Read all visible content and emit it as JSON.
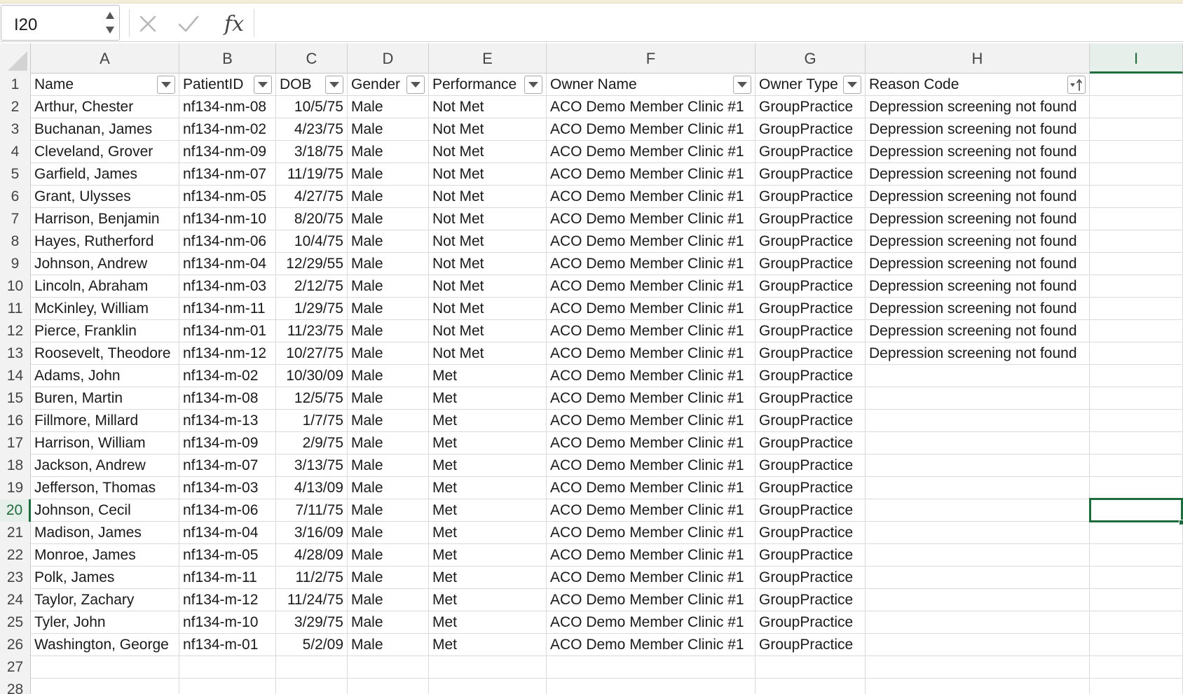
{
  "formula_bar": {
    "name_box": "I20",
    "cancel_icon": "close-icon",
    "enter_icon": "check-icon",
    "function_label": "fx",
    "formula": ""
  },
  "columns": [
    "A",
    "B",
    "C",
    "D",
    "E",
    "F",
    "G",
    "H",
    "I"
  ],
  "active_column": "I",
  "active_row": "20",
  "headers": [
    "Name",
    "PatientID",
    "DOB",
    "Gender",
    "Performance",
    "Owner Name",
    "Owner Type",
    "Reason Code"
  ],
  "sorted_column": "Reason Code",
  "rows": [
    [
      "Arthur, Chester",
      "nf134-nm-08",
      "10/5/75",
      "Male",
      "Not Met",
      "ACO Demo Member Clinic #1",
      "GroupPractice",
      "Depression screening not found"
    ],
    [
      "Buchanan, James",
      "nf134-nm-02",
      "4/23/75",
      "Male",
      "Not Met",
      "ACO Demo Member Clinic #1",
      "GroupPractice",
      "Depression screening not found"
    ],
    [
      "Cleveland, Grover",
      "nf134-nm-09",
      "3/18/75",
      "Male",
      "Not Met",
      "ACO Demo Member Clinic #1",
      "GroupPractice",
      "Depression screening not found"
    ],
    [
      "Garfield, James",
      "nf134-nm-07",
      "11/19/75",
      "Male",
      "Not Met",
      "ACO Demo Member Clinic #1",
      "GroupPractice",
      "Depression screening not found"
    ],
    [
      "Grant, Ulysses",
      "nf134-nm-05",
      "4/27/75",
      "Male",
      "Not Met",
      "ACO Demo Member Clinic #1",
      "GroupPractice",
      "Depression screening not found"
    ],
    [
      "Harrison, Benjamin",
      "nf134-nm-10",
      "8/20/75",
      "Male",
      "Not Met",
      "ACO Demo Member Clinic #1",
      "GroupPractice",
      "Depression screening not found"
    ],
    [
      "Hayes, Rutherford",
      "nf134-nm-06",
      "10/4/75",
      "Male",
      "Not Met",
      "ACO Demo Member Clinic #1",
      "GroupPractice",
      "Depression screening not found"
    ],
    [
      "Johnson, Andrew",
      "nf134-nm-04",
      "12/29/55",
      "Male",
      "Not Met",
      "ACO Demo Member Clinic #1",
      "GroupPractice",
      "Depression screening not found"
    ],
    [
      "Lincoln, Abraham",
      "nf134-nm-03",
      "2/12/75",
      "Male",
      "Not Met",
      "ACO Demo Member Clinic #1",
      "GroupPractice",
      "Depression screening not found"
    ],
    [
      "McKinley, William",
      "nf134-nm-11",
      "1/29/75",
      "Male",
      "Not Met",
      "ACO Demo Member Clinic #1",
      "GroupPractice",
      "Depression screening not found"
    ],
    [
      "Pierce, Franklin",
      "nf134-nm-01",
      "11/23/75",
      "Male",
      "Not Met",
      "ACO Demo Member Clinic #1",
      "GroupPractice",
      "Depression screening not found"
    ],
    [
      "Roosevelt, Theodore",
      "nf134-nm-12",
      "10/27/75",
      "Male",
      "Not Met",
      "ACO Demo Member Clinic #1",
      "GroupPractice",
      "Depression screening not found"
    ],
    [
      "Adams, John",
      "nf134-m-02",
      "10/30/09",
      "Male",
      "Met",
      "ACO Demo Member Clinic #1",
      "GroupPractice",
      ""
    ],
    [
      "Buren, Martin",
      "nf134-m-08",
      "12/5/75",
      "Male",
      "Met",
      "ACO Demo Member Clinic #1",
      "GroupPractice",
      ""
    ],
    [
      "Fillmore, Millard",
      "nf134-m-13",
      "1/7/75",
      "Male",
      "Met",
      "ACO Demo Member Clinic #1",
      "GroupPractice",
      ""
    ],
    [
      "Harrison, William",
      "nf134-m-09",
      "2/9/75",
      "Male",
      "Met",
      "ACO Demo Member Clinic #1",
      "GroupPractice",
      ""
    ],
    [
      "Jackson, Andrew",
      "nf134-m-07",
      "3/13/75",
      "Male",
      "Met",
      "ACO Demo Member Clinic #1",
      "GroupPractice",
      ""
    ],
    [
      "Jefferson, Thomas",
      "nf134-m-03",
      "4/13/09",
      "Male",
      "Met",
      "ACO Demo Member Clinic #1",
      "GroupPractice",
      ""
    ],
    [
      "Johnson, Cecil",
      "nf134-m-06",
      "7/11/75",
      "Male",
      "Met",
      "ACO Demo Member Clinic #1",
      "GroupPractice",
      ""
    ],
    [
      "Madison, James",
      "nf134-m-04",
      "3/16/09",
      "Male",
      "Met",
      "ACO Demo Member Clinic #1",
      "GroupPractice",
      ""
    ],
    [
      "Monroe, James",
      "nf134-m-05",
      "4/28/09",
      "Male",
      "Met",
      "ACO Demo Member Clinic #1",
      "GroupPractice",
      ""
    ],
    [
      "Polk, James",
      "nf134-m-11",
      "11/2/75",
      "Male",
      "Met",
      "ACO Demo Member Clinic #1",
      "GroupPractice",
      ""
    ],
    [
      "Taylor, Zachary",
      "nf134-m-12",
      "11/24/75",
      "Male",
      "Met",
      "ACO Demo Member Clinic #1",
      "GroupPractice",
      ""
    ],
    [
      "Tyler, John",
      "nf134-m-10",
      "3/29/75",
      "Male",
      "Met",
      "ACO Demo Member Clinic #1",
      "GroupPractice",
      ""
    ],
    [
      "Washington, George",
      "nf134-m-01",
      "5/2/09",
      "Male",
      "Met",
      "ACO Demo Member Clinic #1",
      "GroupPractice",
      ""
    ]
  ],
  "trailing_rows": [
    "27",
    "28"
  ],
  "colors": {
    "accent": "#1e6b3c",
    "header_bg": "#f2f2f2",
    "grid_line": "#dadada"
  }
}
